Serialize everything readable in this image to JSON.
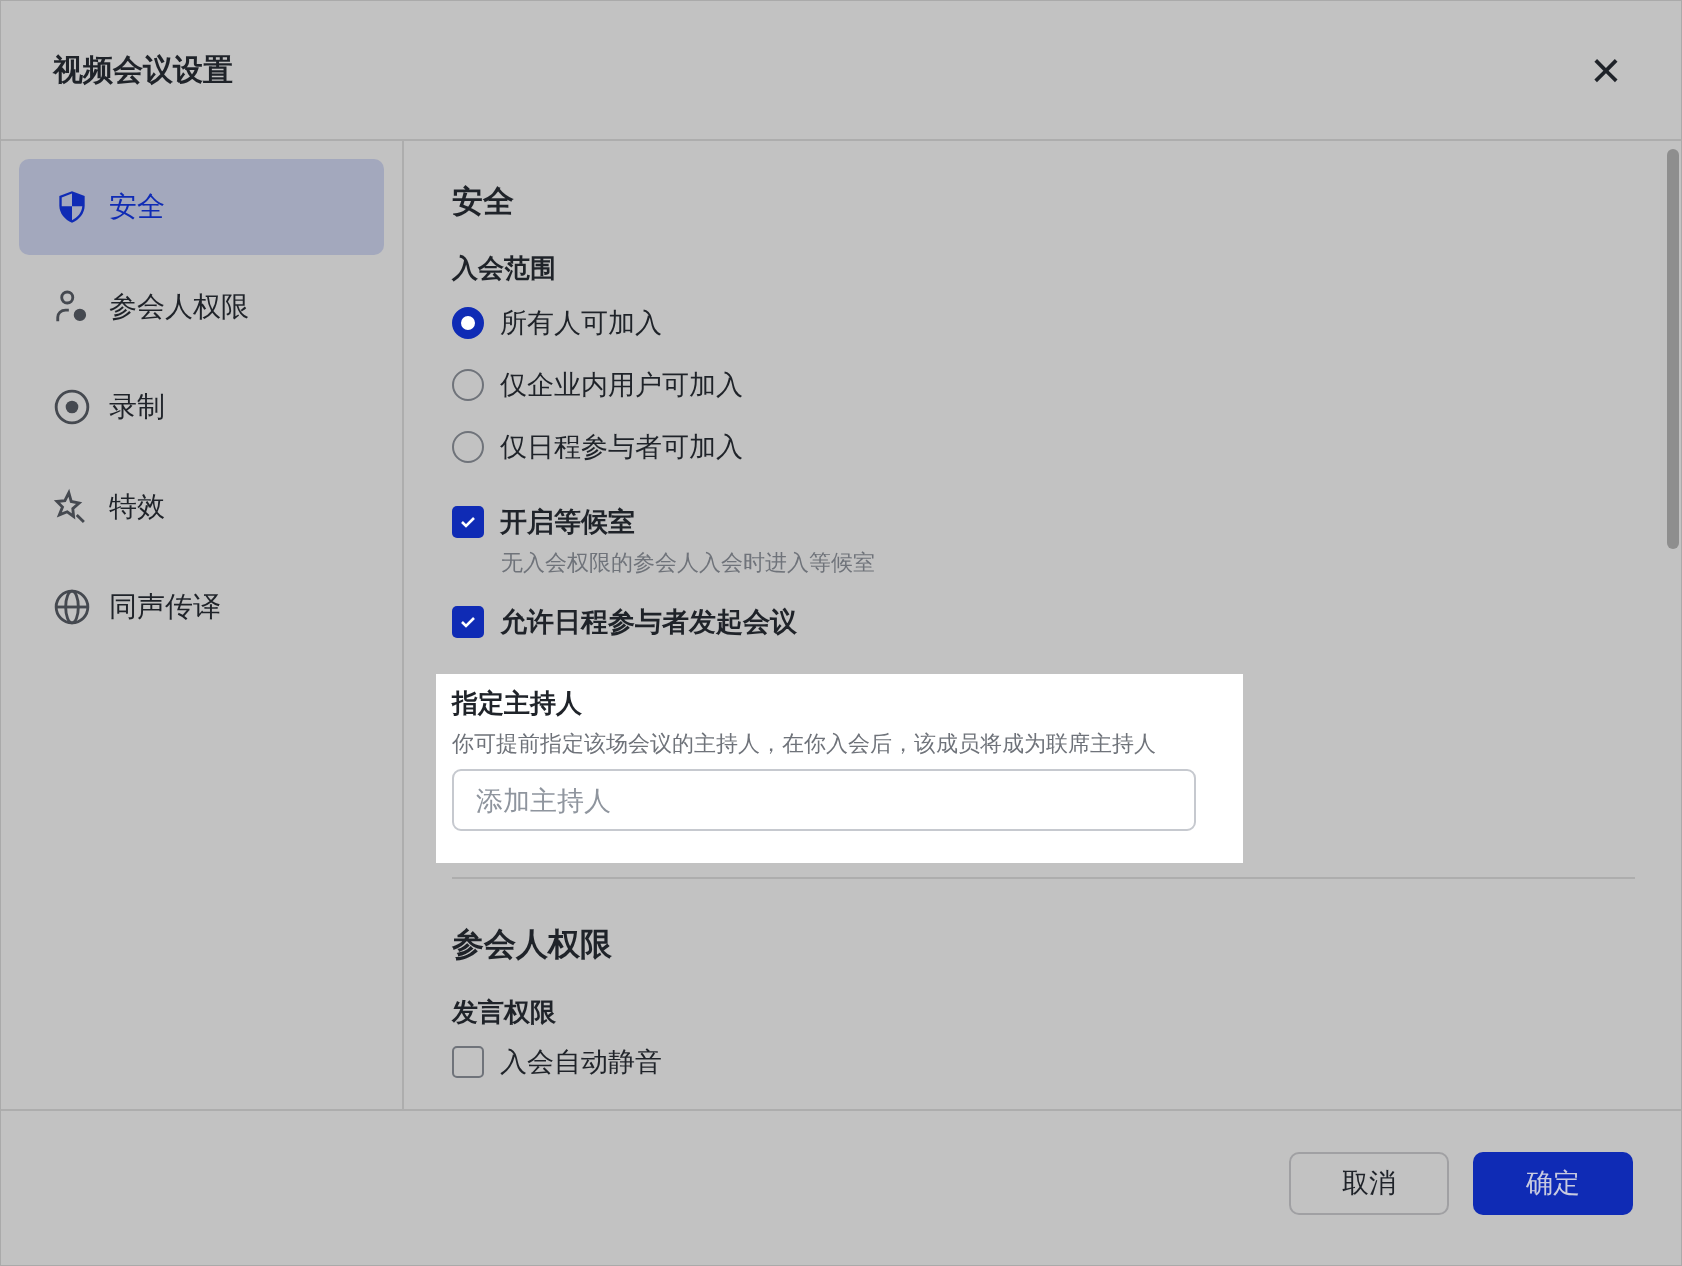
{
  "window": {
    "title": "视频会议设置",
    "close": "×"
  },
  "sidebar": {
    "items": [
      {
        "kind": "shield",
        "label": "安全",
        "selected": true
      },
      {
        "kind": "user-gear",
        "label": "参会人权限",
        "selected": false
      },
      {
        "kind": "record",
        "label": "录制",
        "selected": false
      },
      {
        "kind": "star",
        "label": "特效",
        "selected": false
      },
      {
        "kind": "globe",
        "label": "同声传译",
        "selected": false
      }
    ]
  },
  "security": {
    "title": "安全",
    "join_scope": {
      "label": "入会范围",
      "options": [
        {
          "label": "所有人可加入",
          "selected": true
        },
        {
          "label": "仅企业内用户可加入",
          "selected": false
        },
        {
          "label": "仅日程参与者可加入",
          "selected": false
        }
      ]
    },
    "checks": [
      {
        "label": "开启等候室",
        "checked": true,
        "description": "无入会权限的参会人入会时进入等候室"
      },
      {
        "label": "允许日程参与者发起会议",
        "checked": true
      }
    ],
    "host": {
      "title": "指定主持人",
      "description": "你可提前指定该场会议的主持人，在你入会后，该成员将成为联席主持人",
      "placeholder": "添加主持人"
    }
  },
  "participants": {
    "title": "参会人权限",
    "speaking": {
      "label": "发言权限",
      "checks": [
        {
          "label": "入会自动静音",
          "checked": false
        }
      ]
    }
  },
  "buttons": [
    {
      "kind": "secondary",
      "label": "取消"
    },
    {
      "kind": "primary",
      "label": "确定"
    }
  ]
}
